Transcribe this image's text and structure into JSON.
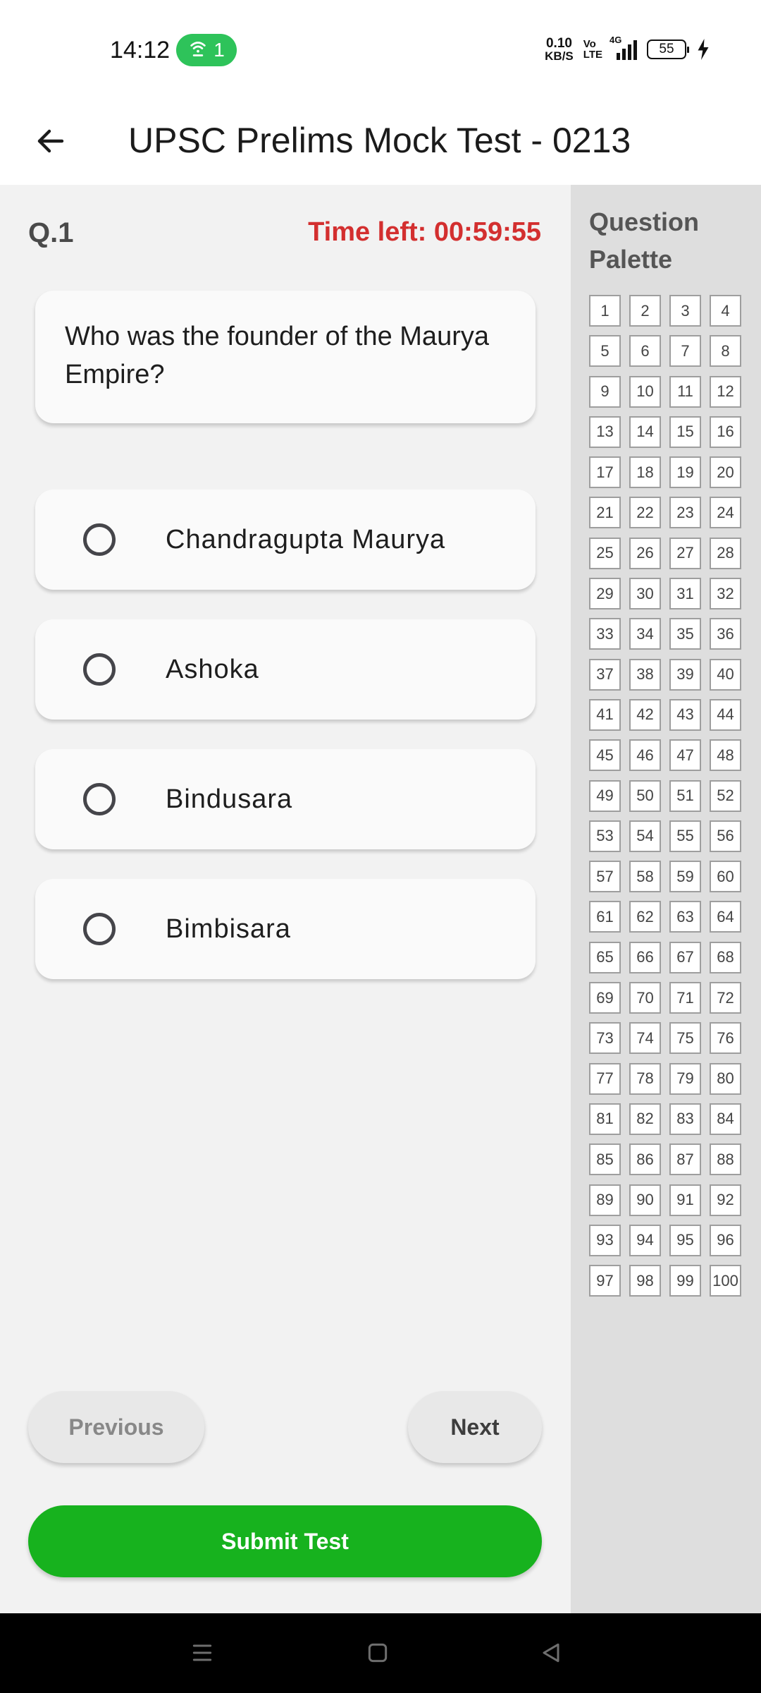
{
  "status_bar": {
    "time": "14:12",
    "hotspot_count": "1",
    "net_speed_value": "0.10",
    "net_speed_unit": "KB/S",
    "volte_top": "Vo",
    "volte_bottom": "LTE",
    "network_type": "4G",
    "battery_level": "55",
    "icons": [
      "hotspot-icon",
      "signal-icon",
      "battery-icon",
      "charging-icon"
    ]
  },
  "app_bar": {
    "title": "UPSC Prelims Mock Test - 0213",
    "back_icon": "arrow-back-icon"
  },
  "quiz": {
    "question_number": "Q.1",
    "time_left": "Time left: 00:59:55",
    "question_text": "Who was the founder of the Maurya Empire?",
    "options": [
      {
        "label": "Chandragupta Maurya",
        "selected": false
      },
      {
        "label": "Ashoka",
        "selected": false
      },
      {
        "label": "Bindusara",
        "selected": false
      },
      {
        "label": "Bimbisara",
        "selected": false
      }
    ],
    "previous_label": "Previous",
    "next_label": "Next",
    "submit_label": "Submit Test"
  },
  "palette": {
    "title": "Question Palette",
    "questions": [
      "1",
      "2",
      "3",
      "4",
      "5",
      "6",
      "7",
      "8",
      "9",
      "10",
      "11",
      "12",
      "13",
      "14",
      "15",
      "16",
      "17",
      "18",
      "19",
      "20",
      "21",
      "22",
      "23",
      "24",
      "25",
      "26",
      "27",
      "28",
      "29",
      "30",
      "31",
      "32",
      "33",
      "34",
      "35",
      "36",
      "37",
      "38",
      "39",
      "40",
      "41",
      "42",
      "43",
      "44",
      "45",
      "46",
      "47",
      "48",
      "49",
      "50",
      "51",
      "52",
      "53",
      "54",
      "55",
      "56",
      "57",
      "58",
      "59",
      "60",
      "61",
      "62",
      "63",
      "64",
      "65",
      "66",
      "67",
      "68",
      "69",
      "70",
      "71",
      "72",
      "73",
      "74",
      "75",
      "76",
      "77",
      "78",
      "79",
      "80",
      "81",
      "82",
      "83",
      "84",
      "85",
      "86",
      "87",
      "88",
      "89",
      "90",
      "91",
      "92",
      "93",
      "94",
      "95",
      "96",
      "97",
      "98",
      "99",
      "100"
    ]
  },
  "colors": {
    "timer": "#d32f2f",
    "submit": "#17b21e",
    "hotspot": "#2ec35a",
    "palette_bg": "#dedede",
    "main_bg": "#f2f2f2"
  },
  "nav_bar": {
    "icons": [
      "menu-icon",
      "home-icon",
      "back-triangle-icon"
    ]
  }
}
